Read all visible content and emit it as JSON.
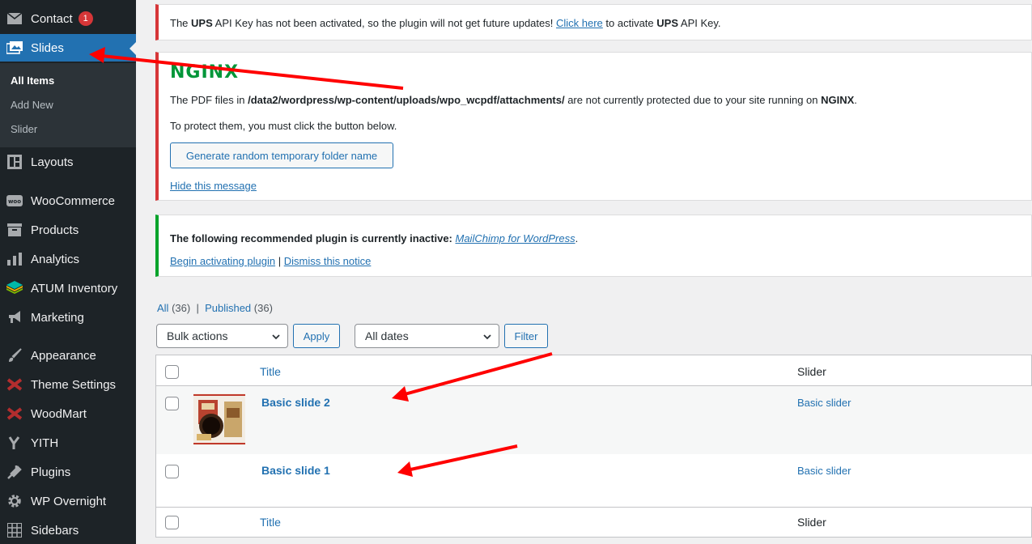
{
  "sidebar": {
    "items": [
      {
        "label": "Contact",
        "icon": "mail-icon",
        "badge": "1"
      },
      {
        "label": "Slides",
        "icon": "slides-icon"
      },
      {
        "label": "Layouts",
        "icon": "layouts-icon"
      },
      {
        "label": "WooCommerce",
        "icon": "woo-icon"
      },
      {
        "label": "Products",
        "icon": "archive-icon"
      },
      {
        "label": "Analytics",
        "icon": "bar-chart-icon"
      },
      {
        "label": "ATUM Inventory",
        "icon": "stack-icon"
      },
      {
        "label": "Marketing",
        "icon": "megaphone-icon"
      },
      {
        "label": "Appearance",
        "icon": "paintbrush-icon"
      },
      {
        "label": "Theme Settings",
        "icon": "woodmart-icon"
      },
      {
        "label": "WoodMart",
        "icon": "woodmart-icon"
      },
      {
        "label": "YITH",
        "icon": "yith-icon"
      },
      {
        "label": "Plugins",
        "icon": "plug-icon"
      },
      {
        "label": "WP Overnight",
        "icon": "gear-icon"
      },
      {
        "label": "Sidebars",
        "icon": "grid-icon"
      }
    ],
    "submenu": [
      "All Items",
      "Add New",
      "Slider"
    ]
  },
  "notices": {
    "ups": {
      "pre": "The ",
      "ups1": "UPS",
      "mid": " API Key has not been activated, so the plugin will not get future updates! ",
      "link": "Click here",
      "post1": " to activate ",
      "ups2": "UPS",
      "post2": " API Key."
    },
    "nginx": {
      "logo": "NGINX",
      "line1_pre": "The PDF files in ",
      "path": "/data2/wordpress/wp-content/uploads/wpo_wcpdf/attachments/",
      "line1_mid": " are not currently protected due to your site running on ",
      "line1_bold": "NGINX",
      "line1_end": ".",
      "line2": "To protect them, you must click the button below.",
      "button": "Generate random temporary folder name",
      "hide": "Hide this message"
    },
    "plugin": {
      "text": "The following recommended plugin is currently inactive: ",
      "plugin_link": "MailChimp for WordPress",
      "end": ".",
      "activate": "Begin activating plugin",
      "sep": "|",
      "dismiss": "Dismiss this notice"
    }
  },
  "filters": {
    "all_label": "All",
    "all_count": "(36)",
    "sep": "|",
    "published_label": "Published",
    "published_count": "(36)",
    "bulk": "Bulk actions",
    "apply": "Apply",
    "dates": "All dates",
    "filter": "Filter"
  },
  "table": {
    "col_title": "Title",
    "col_slider": "Slider",
    "rows": [
      {
        "title": "Basic slide 2",
        "slider": "Basic slider"
      },
      {
        "title": "Basic slide 1",
        "slider": "Basic slider"
      }
    ]
  },
  "colors": {
    "sidebar_bg": "#1d2327",
    "accent": "#2271b1",
    "error": "#d63638",
    "success": "#00a32a",
    "nginx_green": "#009639",
    "annotation_red": "#ff0000"
  }
}
